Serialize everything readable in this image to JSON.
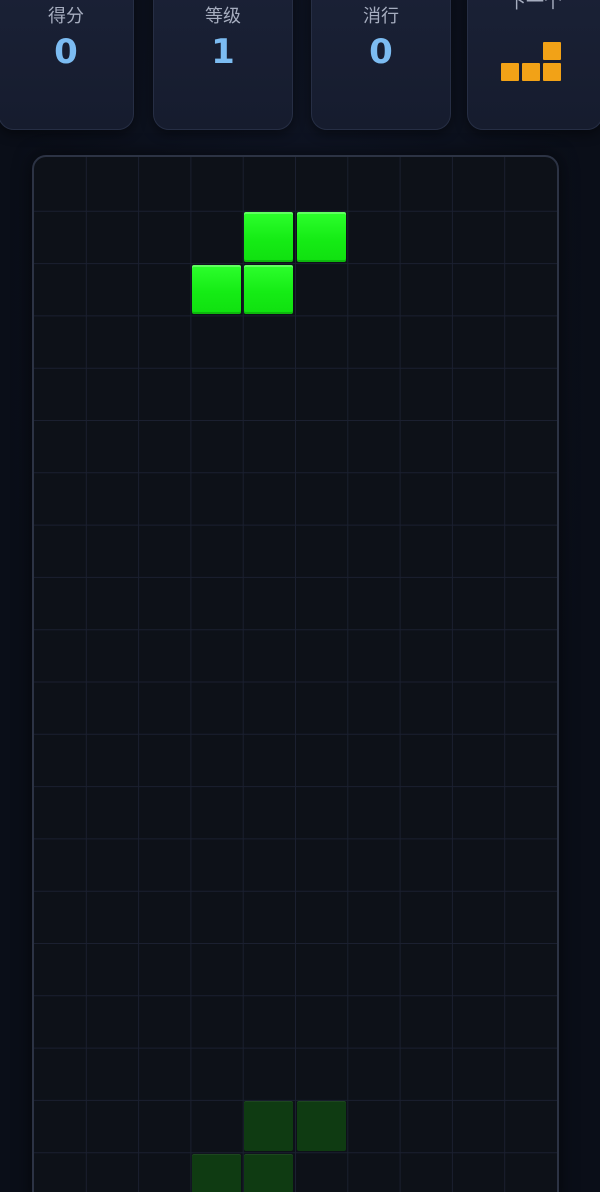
{
  "stats": {
    "score": {
      "label": "得分",
      "value": "0"
    },
    "level": {
      "label": "等级",
      "value": "1"
    },
    "lines": {
      "label": "消行",
      "value": "0"
    },
    "next": {
      "label": "下一个",
      "piece": "L",
      "color": "#f2a217"
    }
  },
  "board": {
    "columns": 10,
    "visible_rows": 20,
    "active_piece": {
      "type": "S",
      "color": "#15ec15"
    },
    "ghost_piece": {
      "type": "S",
      "color": "#0f3b12"
    },
    "grid_line_color": "#1b2030",
    "background_color": "#0d1118"
  }
}
